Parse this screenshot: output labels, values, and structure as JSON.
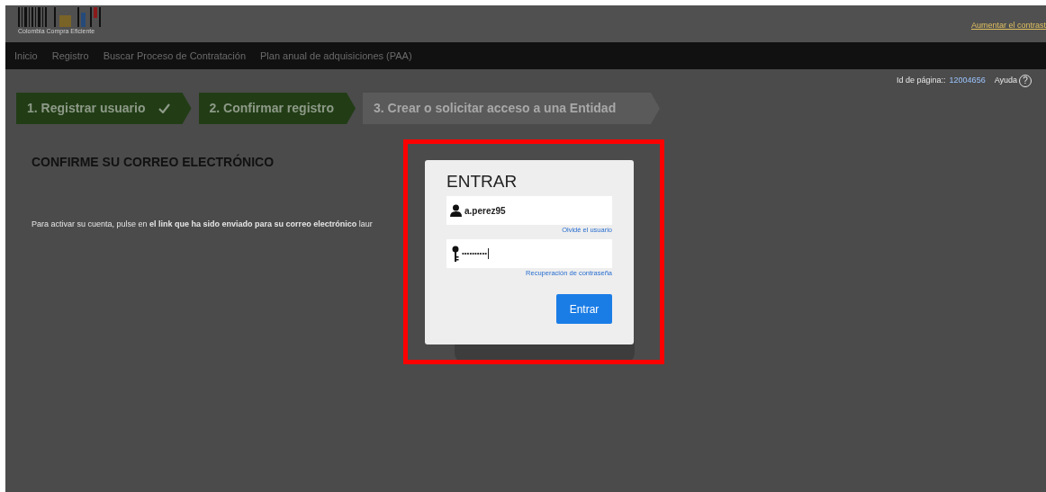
{
  "header": {
    "logo_text": "Colombia Compra Eficiente",
    "contrast_link": "Aumentar el contrast"
  },
  "nav": [
    {
      "label": "Inicio"
    },
    {
      "label": "Registro"
    },
    {
      "label": "Buscar Proceso de Contratación"
    },
    {
      "label": "Plan anual de adquisiciones (PAA)"
    }
  ],
  "page_info": {
    "label": "Id de página::",
    "page_id": "12004656",
    "help": "Ayuda",
    "help_icon": "?"
  },
  "steps": [
    {
      "label": "1. Registrar usuario",
      "kind": "done"
    },
    {
      "label": "2. Confirmar registro",
      "kind": "current"
    },
    {
      "label": "3. Crear o solicitar acceso a una Entidad",
      "kind": "pending"
    }
  ],
  "heading": "CONFIRME SU CORREO ELECTRÓNICO",
  "message": "Para activar su cuenta, pulse en  **el link que ha sido enviado para su correo electrónico** laur",
  "login_dialog": {
    "title": "ENTRAR",
    "username": "a.perez95",
    "forgot_user": "Olvidé el usuario",
    "password": "••••••••••",
    "forgot_password": "Recuperación de contraseña",
    "submit": "Entrar"
  }
}
